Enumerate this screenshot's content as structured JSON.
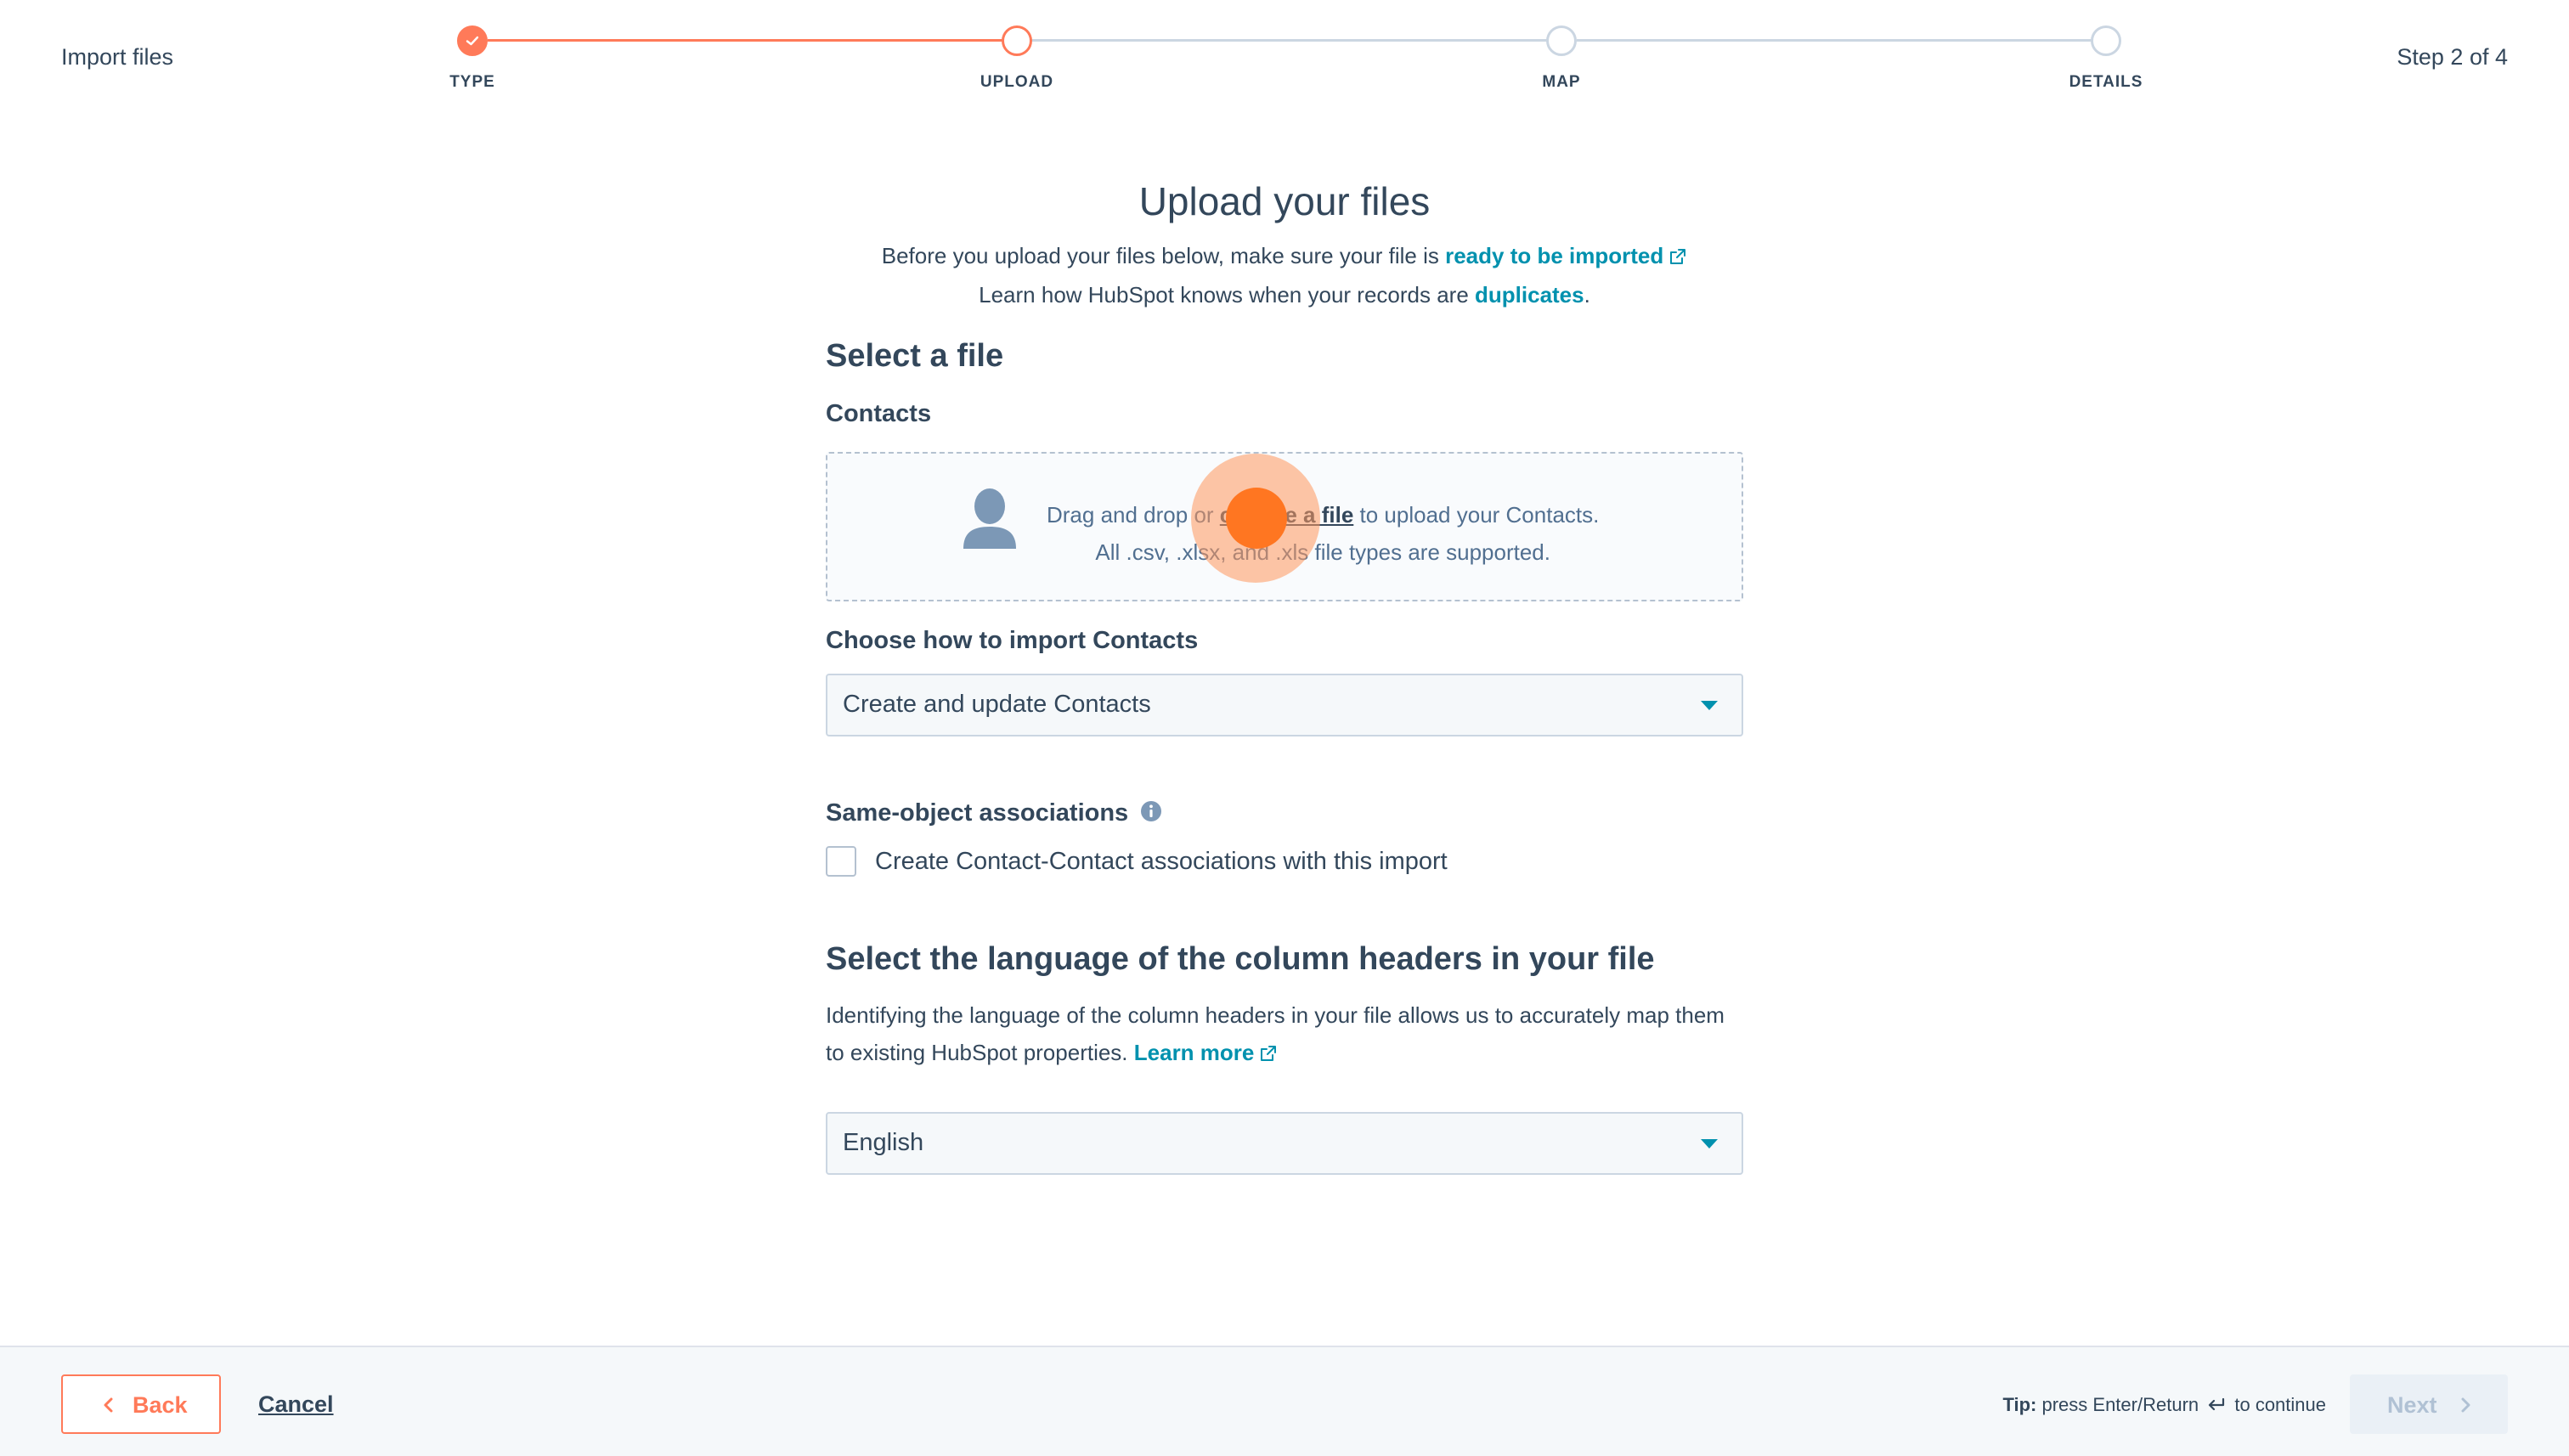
{
  "header": {
    "title": "Import files",
    "step_count": "Step 2 of 4",
    "steps": [
      {
        "label": "TYPE",
        "state": "done"
      },
      {
        "label": "UPLOAD",
        "state": "current"
      },
      {
        "label": "MAP",
        "state": "pending"
      },
      {
        "label": "DETAILS",
        "state": "pending"
      }
    ]
  },
  "main": {
    "title": "Upload your files",
    "intro_line1_prefix": "Before you upload your files below, make sure your file is ",
    "intro_line1_link": "ready to be imported",
    "intro_line2_prefix": "Learn how HubSpot knows when your records are ",
    "intro_line2_link": "duplicates",
    "intro_line2_suffix": ".",
    "select_file_heading": "Select a file",
    "object_label": "Contacts",
    "dropzone": {
      "text_prefix": "Drag and drop or ",
      "link": "choose a file",
      "text_suffix": " to upload your Contacts.",
      "subtext": "All .csv, .xlsx, and .xls file types are supported."
    },
    "import_method_label": "Choose how to import Contacts",
    "import_method_value": "Create and update Contacts",
    "associations_label": "Same-object associations",
    "associations_checkbox_label": "Create Contact-Contact associations with this import",
    "associations_checked": false,
    "language_heading": "Select the language of the column headers in your file",
    "language_desc_prefix": "Identifying the language of the column headers in your file allows us to accurately map them to existing HubSpot properties. ",
    "language_desc_link": "Learn more",
    "language_value": "English"
  },
  "footer": {
    "back_label": "Back",
    "cancel_label": "Cancel",
    "tip_bold": "Tip:",
    "tip_prefix": " press Enter/Return ",
    "tip_suffix": " to continue",
    "next_label": "Next"
  },
  "colors": {
    "accent": "#ff7a59",
    "link": "#0091ae",
    "text": "#33475b",
    "border": "#cbd6e2"
  }
}
